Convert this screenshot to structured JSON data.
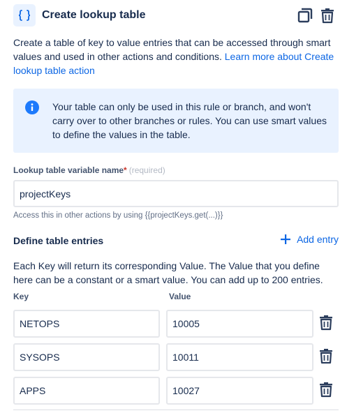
{
  "header": {
    "title": "Create lookup table",
    "icon": "curly-braces-icon",
    "actions": [
      "duplicate-icon",
      "trash-icon"
    ]
  },
  "description": {
    "text": "Create a table of key to value entries that can be accessed through smart values and used in other actions and conditions. ",
    "link": "Learn more about Create lookup table action"
  },
  "info": {
    "icon": "info-icon",
    "text": "Your table can only be used in this rule or branch, and won't carry over to other branches or rules. You can use smart values to define the values in the table."
  },
  "variable_field": {
    "label": "Lookup table variable name",
    "required_mark": "*",
    "required_text": "(required)",
    "value": "projectKeys",
    "helper": "Access this in other actions by using {{projectKeys.get(...)}}"
  },
  "entries": {
    "title": "Define table entries",
    "add_label": "Add entry",
    "description": "Each Key will return its corresponding Value. The Value that you define here can be a constant or a smart value. You can add up to 200 entries.",
    "key_header": "Key",
    "value_header": "Value",
    "rows": [
      {
        "key": "NETOPS",
        "value": "10005"
      },
      {
        "key": "SYSOPS",
        "value": "10011"
      },
      {
        "key": "APPS",
        "value": "10027"
      }
    ]
  },
  "colors": {
    "accent": "#0c66e4",
    "info_bg": "#e9f2ff",
    "required": "#c9372c"
  }
}
